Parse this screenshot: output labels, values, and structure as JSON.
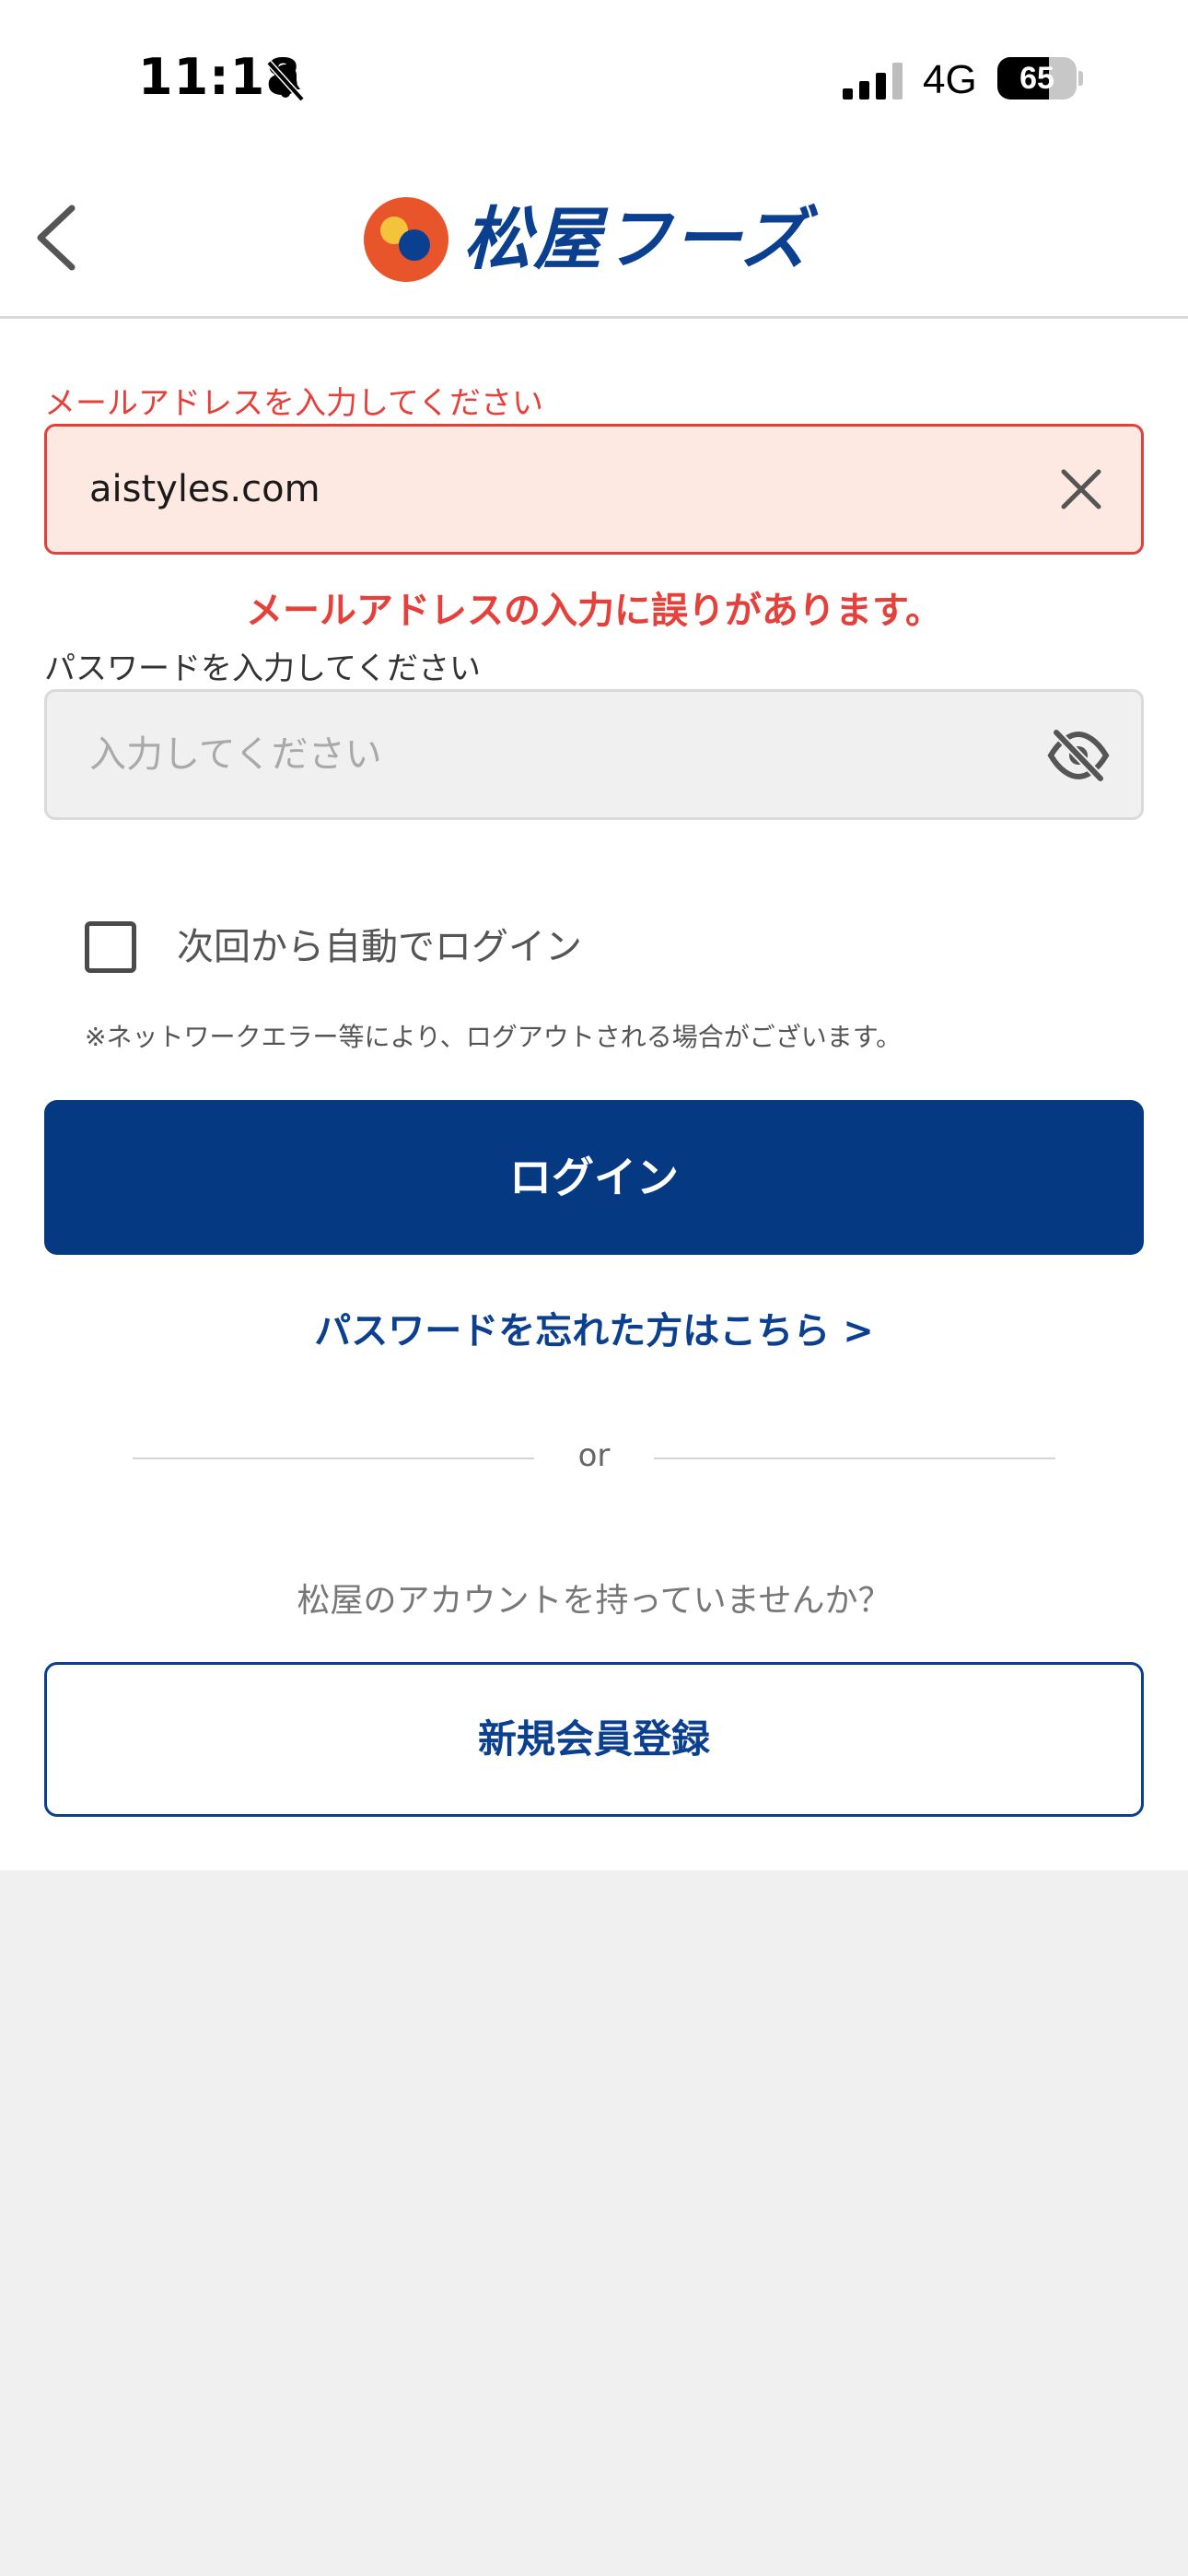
{
  "status_bar": {
    "time": "11:18",
    "network": "4G",
    "battery_level": "65",
    "battery_fraction": 0.65
  },
  "header": {
    "logo_text": "松屋フーズ",
    "brand_colors": {
      "navy": "#0b3f8f",
      "orange": "#e8552b",
      "yellow": "#f5c33b"
    }
  },
  "form": {
    "email": {
      "label": "メールアドレスを入力してください",
      "value": "aistyles.com",
      "error": "メールアドレスの入力に誤りがあります。"
    },
    "password": {
      "label": "パスワードを入力してください",
      "placeholder": "入力してください"
    },
    "remember_me": {
      "label": "次回から自動でログイン",
      "checked": false,
      "note": "※ネットワークエラー等により、ログアウトされる場合がございます。"
    },
    "login_button": "ログイン",
    "forgot_link": "パスワードを忘れた方はこちら >"
  },
  "divider": {
    "text": "or"
  },
  "register": {
    "prompt": "松屋のアカウントを持っていませんか？",
    "button": "新規会員登録"
  },
  "icons": [
    "bell-slash-icon",
    "cellular-signal-icon",
    "battery-icon",
    "back-chevron-icon",
    "clear-icon",
    "eye-slash-icon"
  ],
  "colors": {
    "error": "#e5403a",
    "primary": "#053a82",
    "error_field_bg": "#fde9e2"
  }
}
